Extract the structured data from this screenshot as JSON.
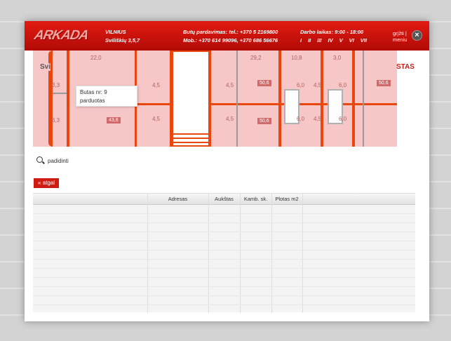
{
  "header": {
    "logo": "ARKADA",
    "city": "VILNIUS",
    "address": "Sviliškių 3,5,7",
    "sales_line": "Butų pardavimas: tel.: +370 5 2169800",
    "mobile_line": "Mob.: +370 614 99096, +370 686 56676",
    "hours_line": "Darbo laikas: 9:00 - 18:00",
    "days": [
      "I",
      "II",
      "III",
      "IV",
      "V",
      "VI",
      "VII"
    ],
    "back_to_menu_line1": "grįžti |",
    "back_to_menu_line2": "meniu",
    "close_icon": "close-icon"
  },
  "plan": {
    "title_left": "Svi",
    "title_right": "STAS",
    "room_labels": [
      "22,0",
      "3,3",
      "4,5",
      "4,5",
      "4,5",
      "6,3",
      "4,5",
      "29,2",
      "10,8",
      "3,0",
      "4,5",
      "4,5",
      "6,0",
      "6,0",
      "6,0",
      "6,0"
    ],
    "room_tags": [
      "43,8",
      "50,6",
      "50,6",
      "50,6"
    ]
  },
  "tooltip": {
    "label": "Butas nr:",
    "number": "9",
    "status": "parduotas"
  },
  "zoom": {
    "label": "padidinti"
  },
  "back_button": {
    "label": "« atgal"
  },
  "table": {
    "columns": [
      "",
      "Adresas",
      "Aukštas",
      "Kamb. sk.",
      "Plotas m2",
      ""
    ],
    "rows": []
  }
}
